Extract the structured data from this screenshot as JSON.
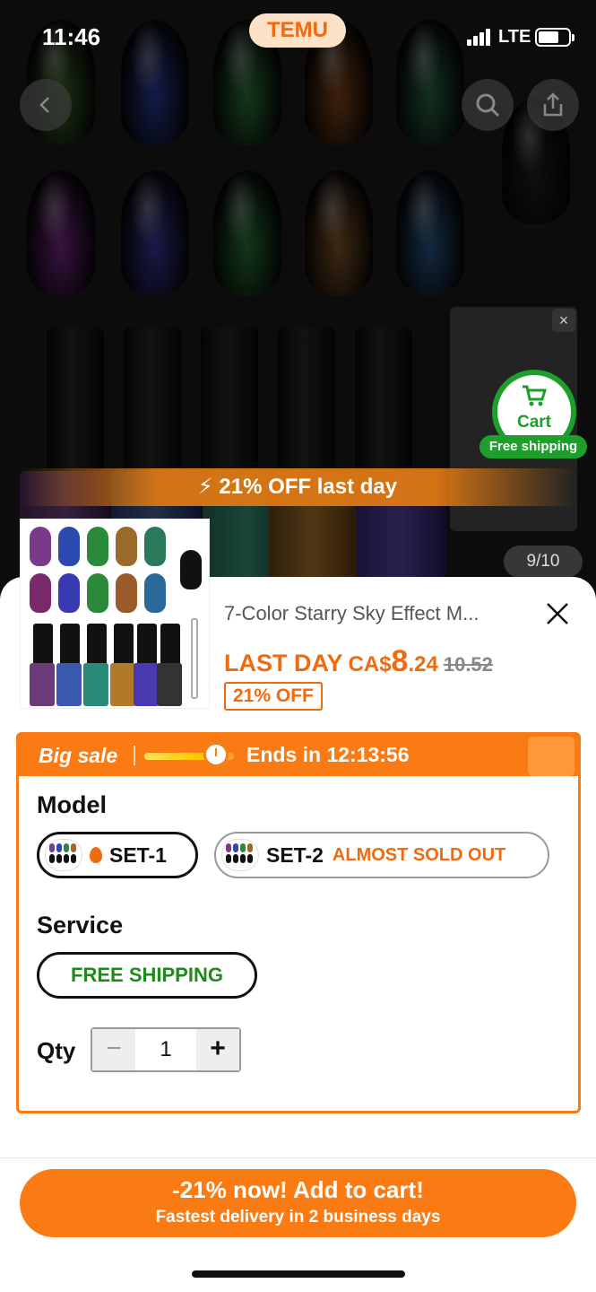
{
  "status_bar": {
    "time": "11:46",
    "network": "LTE",
    "app_badge": "TEMU"
  },
  "gallery": {
    "promo_banner": "21% OFF last day",
    "page_indicator": "9/10",
    "cart_fab": {
      "label": "Cart",
      "badge": "Free shipping"
    }
  },
  "product": {
    "title": "7-Color Starry Sky Effect M...",
    "last_day_label": "LAST DAY",
    "currency": "CA$",
    "price_main": "8",
    "price_cents": ".24",
    "original_price": "10.52",
    "discount_badge": "21% OFF"
  },
  "sale_panel": {
    "big_sale_label": "Big sale",
    "ends_in": "Ends in 12:13:56",
    "model_label": "Model",
    "models": [
      {
        "name": "SET-1",
        "selected": true
      },
      {
        "name": "SET-2",
        "note": "ALMOST SOLD OUT",
        "selected": false
      }
    ],
    "service_label": "Service",
    "service_option": "FREE SHIPPING",
    "qty_label": "Qty",
    "qty_value": "1"
  },
  "cta": {
    "line1": "-21% now! Add to cart!",
    "line2": "Fastest delivery in 2 business days"
  },
  "colors": {
    "accent": "#fa7a14",
    "green": "#1e9e2a"
  }
}
